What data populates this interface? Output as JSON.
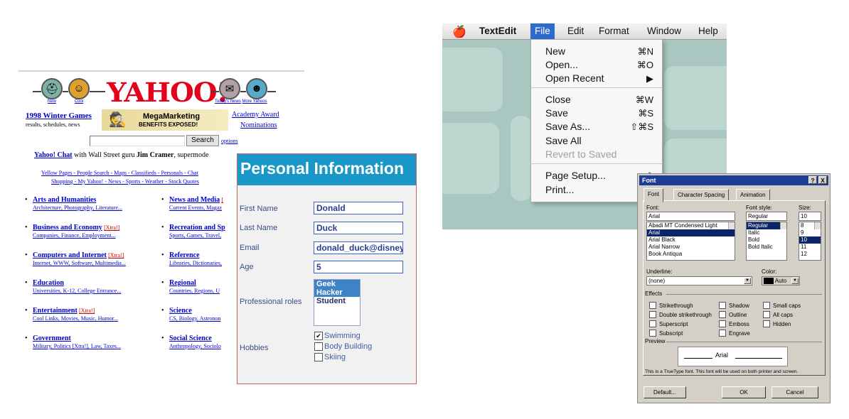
{
  "yahoo": {
    "icons": [
      {
        "name": "new",
        "caption": "New"
      },
      {
        "name": "cool",
        "caption": "Cool"
      },
      {
        "name": "todays-news",
        "caption": "Today's News"
      },
      {
        "name": "more-yahoos",
        "caption": "More Yahoos"
      }
    ],
    "logo": "YAHOO!",
    "winter_games": "1998 Winter Games",
    "winter_games_sub": "results, schedules, news",
    "ad_line1": "MegaMarketing",
    "ad_line2": "BENEFITS EXPOSED!",
    "academy_line1": "Academy Award",
    "academy_line2": "Nominations",
    "search_button": "Search",
    "options_link": "options",
    "chat_link": "Yahoo! Chat",
    "chat_text1": " with Wall Street guru ",
    "chat_bold": "Jim Cramer",
    "chat_text2": ", supermode",
    "links_row1": "Yellow Pages - People Search - Maps - Classifieds - Personals - Chat",
    "links_row2": "Shopping - My Yahoo! - News - Sports - Weather - Stock Quotes",
    "categories_left": [
      {
        "title": "Arts and Humanities",
        "xtra": "",
        "sub": "Architecture, Photography, Literature..."
      },
      {
        "title": "Business and Economy",
        "xtra": "[Xtra!]",
        "sub": "Companies, Finance, Employment..."
      },
      {
        "title": "Computers and Internet",
        "xtra": "[Xtra!]",
        "sub": "Internet, WWW, Software, Multimedia..."
      },
      {
        "title": "Education",
        "xtra": "",
        "sub": "Universities, K-12, College Entrance..."
      },
      {
        "title": "Entertainment",
        "xtra": "[Xtra!]",
        "sub": "Cool Links, Movies, Music, Humor..."
      },
      {
        "title": "Government",
        "xtra": "",
        "sub": "Military, Politics [Xtra!], Law, Taxes..."
      }
    ],
    "categories_right": [
      {
        "title": "News and Media",
        "xtra": "[",
        "sub": "Current Events, Magaz"
      },
      {
        "title": "Recreation and Sp",
        "xtra": "",
        "sub": "Sports, Games, Travel,"
      },
      {
        "title": "Reference",
        "xtra": "",
        "sub": "Libraries, Dictionaries,"
      },
      {
        "title": "Regional",
        "xtra": "",
        "sub": "Countries, Regions, U"
      },
      {
        "title": "Science",
        "xtra": "",
        "sub": "CS, Biology, Astronon"
      },
      {
        "title": "Social Science",
        "xtra": "",
        "sub": "Anthropology, Sociolo"
      }
    ]
  },
  "form": {
    "title": "Personal Information",
    "first_name_label": "First Name",
    "first_name_value": "Donald",
    "last_name_label": "Last Name",
    "last_name_value": "Duck",
    "email_label": "Email",
    "email_value": "donald_duck@disneyl",
    "age_label": "Age",
    "age_value": "5",
    "roles_label": "Professional roles",
    "roles": [
      {
        "label": "Geek",
        "selected": true
      },
      {
        "label": "Hacker",
        "selected": true
      },
      {
        "label": "Student",
        "selected": false
      }
    ],
    "hobbies_label": "Hobbies",
    "hobbies": [
      {
        "label": "Swimming",
        "checked": true
      },
      {
        "label": "Body Building",
        "checked": false
      },
      {
        "label": "Skiing",
        "checked": false
      }
    ]
  },
  "textedit": {
    "app_name": "TextEdit",
    "menus": [
      "File",
      "Edit",
      "Format",
      "Window",
      "Help"
    ],
    "active_menu": "File",
    "items": [
      {
        "label": "New",
        "shortcut": "⌘N",
        "disabled": false
      },
      {
        "label": "Open...",
        "shortcut": "⌘O",
        "disabled": false
      },
      {
        "label": "Open Recent",
        "shortcut": "▶",
        "disabled": false
      },
      {
        "label": "Close",
        "shortcut": "⌘W",
        "disabled": false
      },
      {
        "label": "Save",
        "shortcut": "⌘S",
        "disabled": false
      },
      {
        "label": "Save As...",
        "shortcut": "⇧⌘S",
        "disabled": false
      },
      {
        "label": "Save All",
        "shortcut": "",
        "disabled": false
      },
      {
        "label": "Revert to Saved",
        "shortcut": "",
        "disabled": true
      },
      {
        "label": "Page Setup...",
        "shortcut": "⇧",
        "disabled": false
      },
      {
        "label": "Print...",
        "shortcut": "",
        "disabled": false
      }
    ]
  },
  "font_dialog": {
    "title": "Font",
    "help_btn": "?",
    "close_btn": "X",
    "tabs": [
      "Font",
      "Character Spacing",
      "Animation"
    ],
    "font_label": "Font:",
    "font_value": "Arial",
    "font_list": [
      "Abadi MT Condensed Light",
      "Arial",
      "Arial Black",
      "Arial Narrow",
      "Book Antiqua"
    ],
    "font_selected": "Arial",
    "style_label": "Font style:",
    "style_value": "Regular",
    "style_list": [
      "Regular",
      "Italic",
      "Bold",
      "Bold Italic"
    ],
    "style_selected": "Regular",
    "size_label": "Size:",
    "size_value": "10",
    "size_list": [
      "8",
      "9",
      "10",
      "11",
      "12"
    ],
    "size_selected": "10",
    "underline_label": "Underline:",
    "underline_value": "(none)",
    "color_label": "Color:",
    "color_value": "Auto",
    "color_swatch": "#000000",
    "effects_label": "Effects",
    "effects": [
      [
        "Strikethrough",
        "Shadow",
        "Small caps"
      ],
      [
        "Double strikethrough",
        "Outline",
        "All caps"
      ],
      [
        "Superscript",
        "Emboss",
        "Hidden"
      ],
      [
        "Subscript",
        "Engrave",
        ""
      ]
    ],
    "preview_label": "Preview",
    "preview_text": "Arial",
    "info_text": "This is a TrueType font. This font will be used on both printer and screen.",
    "default_button": "Default...",
    "ok_button": "OK",
    "cancel_button": "Cancel"
  }
}
